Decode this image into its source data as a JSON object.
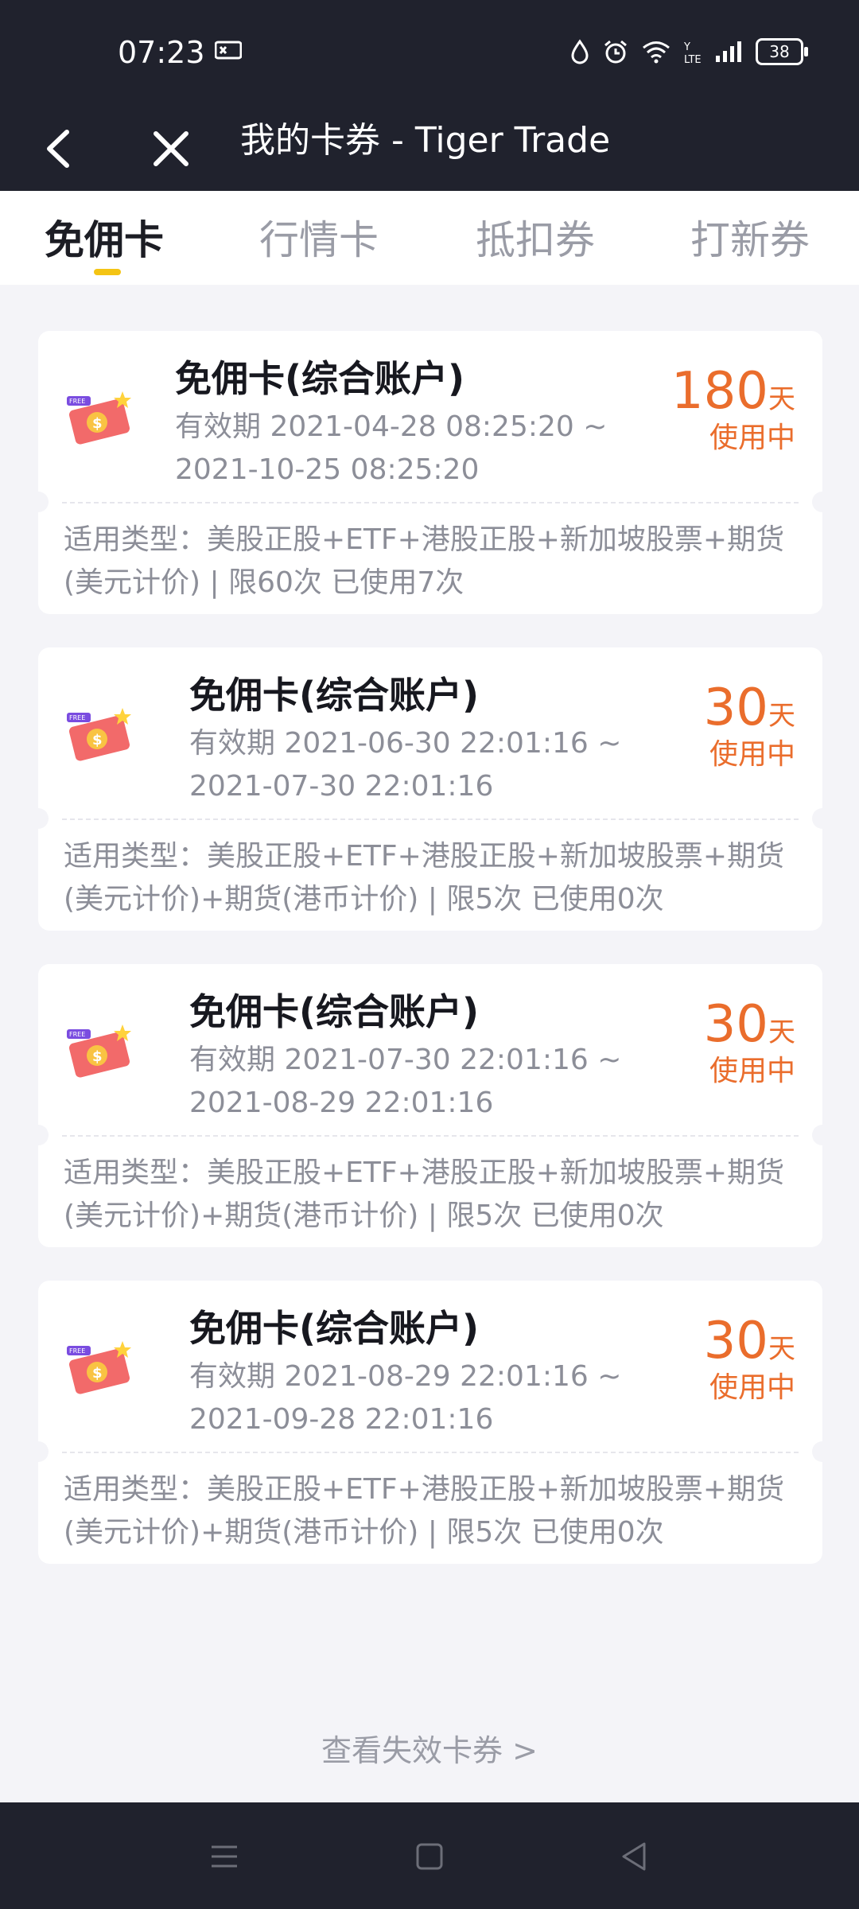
{
  "status_bar": {
    "time": "07:23",
    "battery": "38",
    "icons": [
      "app-notification-icon",
      "drop-icon",
      "alarm-icon",
      "wifi-icon",
      "volte-icon",
      "signal-icon",
      "battery-icon"
    ]
  },
  "header": {
    "title": "我的卡券 - Tiger Trade",
    "icons": [
      "back-arrow-icon",
      "close-icon"
    ]
  },
  "tabs": [
    {
      "label": "免佣卡",
      "active": true
    },
    {
      "label": "行情卡",
      "active": false
    },
    {
      "label": "抵扣券",
      "active": false
    },
    {
      "label": "打新券",
      "active": false
    }
  ],
  "cards": [
    {
      "name": "免佣卡(综合账户)",
      "validity_line1": "有效期 2021-04-28 08:25:20 ~",
      "validity_line2": "2021-10-25 08:25:20",
      "days": "180",
      "days_unit": "天",
      "status": "使用中",
      "desc": "适用类型：美股正股+ETF+港股正股+新加坡股票+期货(美元计价) | 限60次 已使用7次"
    },
    {
      "name": "免佣卡(综合账户)",
      "validity_line1": "有效期 2021-06-30 22:01:16 ~",
      "validity_line2": "2021-07-30 22:01:16",
      "days": "30",
      "days_unit": "天",
      "status": "使用中",
      "desc": "适用类型：美股正股+ETF+港股正股+新加坡股票+期货(美元计价)+期货(港币计价) | 限5次 已使用0次"
    },
    {
      "name": "免佣卡(综合账户)",
      "validity_line1": "有效期 2021-07-30 22:01:16 ~",
      "validity_line2": "2021-08-29 22:01:16",
      "days": "30",
      "days_unit": "天",
      "status": "使用中",
      "desc": "适用类型：美股正股+ETF+港股正股+新加坡股票+期货(美元计价)+期货(港币计价) | 限5次 已使用0次"
    },
    {
      "name": "免佣卡(综合账户)",
      "validity_line1": "有效期 2021-08-29 22:01:16 ~",
      "validity_line2": "2021-09-28 22:01:16",
      "days": "30",
      "days_unit": "天",
      "status": "使用中",
      "desc": "适用类型：美股正股+ETF+港股正股+新加坡股票+期货(美元计价)+期货(港币计价) | 限5次 已使用0次"
    }
  ],
  "footer_link": "查看失效卡券 >",
  "nav_bar": {
    "icons": [
      "menu-icon",
      "home-square-icon",
      "back-triangle-icon"
    ]
  },
  "colors": {
    "accent_orange": "#ea6d2c",
    "tab_indicator": "#f4c414",
    "dark_bar": "#20222d"
  }
}
